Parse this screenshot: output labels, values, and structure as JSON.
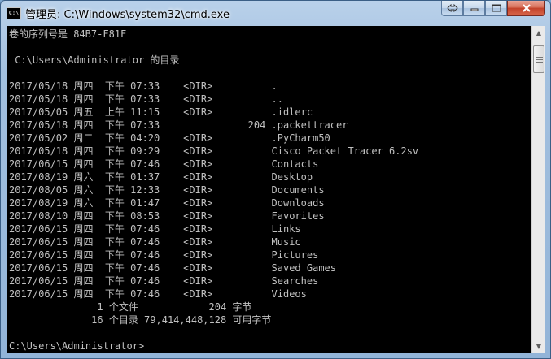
{
  "window": {
    "title": "管理员: C:\\Windows\\system32\\cmd.exe",
    "icon": "cmd-icon"
  },
  "caption_buttons": [
    {
      "name": "restore-prev-button",
      "icon": "swap-icon"
    },
    {
      "name": "minimize-button",
      "icon": "minimize-icon"
    },
    {
      "name": "maximize-button",
      "icon": "maximize-icon"
    },
    {
      "name": "close-button",
      "icon": "close-icon"
    }
  ],
  "console": {
    "lines": [
      "卷的序列号是 84B7-F81F",
      "",
      " C:\\Users\\Administrator 的目录",
      "",
      "2017/05/18 周四  下午 07:33    <DIR>          .",
      "2017/05/18 周四  下午 07:33    <DIR>          ..",
      "2017/05/05 周五  上午 11:15    <DIR>          .idlerc",
      "2017/05/18 周四  下午 07:33               204 .packettracer",
      "2017/05/02 周二  下午 04:20    <DIR>          .PyCharm50",
      "2017/05/18 周四  下午 09:29    <DIR>          Cisco Packet Tracer 6.2sv",
      "2017/06/15 周四  下午 07:46    <DIR>          Contacts",
      "2017/08/19 周六  下午 01:37    <DIR>          Desktop",
      "2017/08/05 周六  下午 12:33    <DIR>          Documents",
      "2017/08/19 周六  下午 01:47    <DIR>          Downloads",
      "2017/08/10 周四  下午 08:53    <DIR>          Favorites",
      "2017/06/15 周四  下午 07:46    <DIR>          Links",
      "2017/06/15 周四  下午 07:46    <DIR>          Music",
      "2017/06/15 周四  下午 07:46    <DIR>          Pictures",
      "2017/06/15 周四  下午 07:46    <DIR>          Saved Games",
      "2017/06/15 周四  下午 07:46    <DIR>          Searches",
      "2017/06/15 周四  下午 07:46    <DIR>          Videos",
      "               1 个文件            204 字节",
      "              16 个目录 79,414,448,128 可用字节",
      "",
      "C:\\Users\\Administrator>"
    ]
  },
  "scrollbar": {
    "up_icon": "scroll-up-arrow-icon",
    "down_icon": "scroll-down-arrow-icon"
  }
}
